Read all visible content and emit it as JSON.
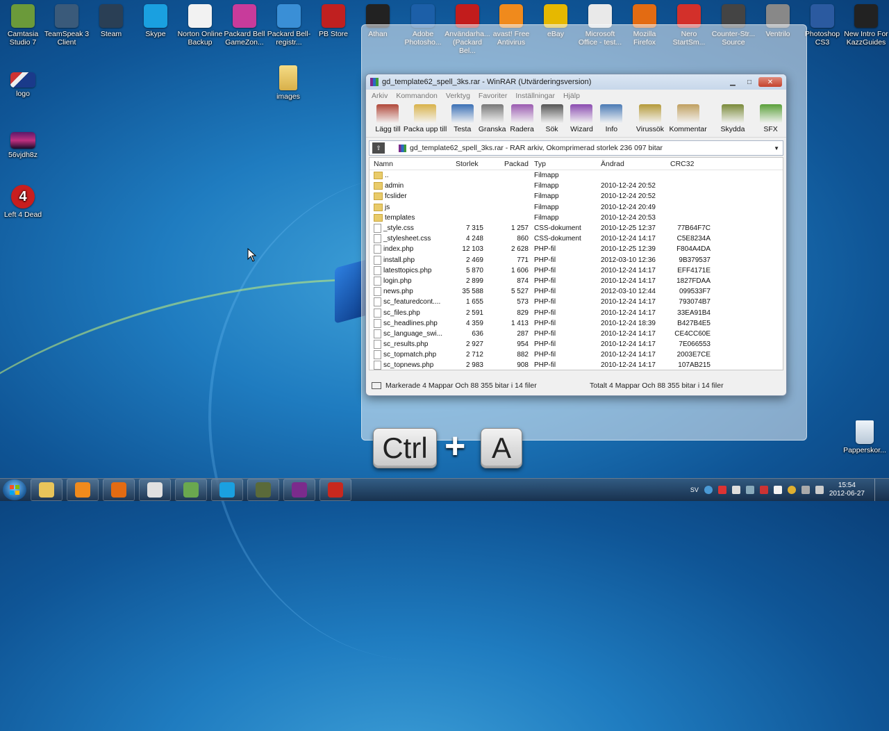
{
  "desktop": {
    "icons_top": [
      {
        "label": "Camtasia Studio 7",
        "icon": "camtasia-icon",
        "color": "#6b9a3a"
      },
      {
        "label": "TeamSpeak 3 Client",
        "icon": "teamspeak-icon",
        "color": "#3a5a7a"
      },
      {
        "label": "Steam",
        "icon": "steam-icon",
        "color": "#2a3f55"
      },
      {
        "label": "Skype",
        "icon": "skype-icon",
        "color": "#1aa0e0"
      },
      {
        "label": "Norton Online Backup",
        "icon": "norton-icon",
        "color": "#f2f2f2"
      },
      {
        "label": "Packard Bell GameZon...",
        "icon": "gamezone-icon",
        "color": "#c83b9b"
      },
      {
        "label": "Packard Bell-registr...",
        "icon": "packardbell-icon",
        "color": "#3a8fd6"
      },
      {
        "label": "PB Store",
        "icon": "pbstore-icon",
        "color": "#c02020"
      },
      {
        "label": "Athan",
        "icon": "athan-icon",
        "color": "#222222"
      },
      {
        "label": "Adobe Photosho...",
        "icon": "photoshop-elements-icon",
        "color": "#1c5fa8"
      },
      {
        "label": "Användarha... (Packard Bel...",
        "icon": "help-icon",
        "color": "#c21c1c"
      },
      {
        "label": "avast! Free Antivirus",
        "icon": "avast-icon",
        "color": "#f08a1c"
      },
      {
        "label": "eBay",
        "icon": "ebay-icon",
        "color": "#e6b800"
      },
      {
        "label": "Microsoft Office - test...",
        "icon": "office-icon",
        "color": "#e9e9e9"
      },
      {
        "label": "Mozilla Firefox",
        "icon": "firefox-icon",
        "color": "#e36b12"
      },
      {
        "label": "Nero StartSm...",
        "icon": "nero-icon",
        "color": "#d3302a"
      },
      {
        "label": "Counter-Str... Source",
        "icon": "counterstrike-icon",
        "color": "#444444"
      },
      {
        "label": "Ventrilo",
        "icon": "ventrilo-icon",
        "color": "#888888"
      },
      {
        "label": "Photoshop CS3",
        "icon": "photoshop-icon",
        "color": "#2b5aa0"
      },
      {
        "label": "New Intro For KazzGuides",
        "icon": "kazzguides-icon",
        "color": "#222222"
      }
    ],
    "icons_left": [
      {
        "label": "logo",
        "icon": "logo-image-icon"
      },
      {
        "label": "56vjdh8z",
        "icon": "image-file-icon"
      },
      {
        "label": "Left 4 Dead",
        "icon": "left4dead-icon"
      }
    ],
    "folder_label": "images",
    "recycle_label": "Papperskor..."
  },
  "winrar": {
    "title": "gd_template62_spell_3ks.rar - WinRAR (Utvärderingsversion)",
    "menu": [
      "Arkiv",
      "Kommandon",
      "Verktyg",
      "Favoriter",
      "Inställningar",
      "Hjälp"
    ],
    "toolbar": [
      {
        "label": "Lägg till",
        "icon": "add-archive-icon",
        "color": "#b0483a"
      },
      {
        "label": "Packa upp till",
        "icon": "extract-folder-icon",
        "color": "#d8b24a"
      },
      {
        "label": "Testa",
        "icon": "test-icon",
        "color": "#3a6fb5"
      },
      {
        "label": "Granska",
        "icon": "view-glasses-icon",
        "color": "#777777"
      },
      {
        "label": "Radera",
        "icon": "delete-icon",
        "color": "#9a5ab0"
      },
      {
        "label": "Sök",
        "icon": "find-binoculars-icon",
        "color": "#555555"
      },
      {
        "label": "Wizard",
        "icon": "wizard-icon",
        "color": "#8a4bb0"
      },
      {
        "label": "Info",
        "icon": "info-icon",
        "color": "#4a7ab5"
      },
      {
        "label": "Virussök",
        "icon": "virus-scan-icon",
        "color": "#b59a3a"
      },
      {
        "label": "Kommentar",
        "icon": "comment-icon",
        "color": "#c0a060"
      },
      {
        "label": "Skydda",
        "icon": "protect-shield-icon",
        "color": "#7a8a3a"
      },
      {
        "label": "SFX",
        "icon": "sfx-icon",
        "color": "#5aa03a"
      }
    ],
    "address": "gd_template62_spell_3ks.rar - RAR arkiv, Okomprimerad storlek 236 097 bitar",
    "columns": {
      "name": "Namn",
      "size": "Storlek",
      "packed": "Packad",
      "type": "Typ",
      "modified": "Ändrad",
      "crc": "CRC32"
    },
    "rows": [
      {
        "name": "..",
        "size": "",
        "packed": "",
        "type": "Filmapp",
        "modified": "",
        "crc": "",
        "kind": "folder"
      },
      {
        "name": "admin",
        "size": "",
        "packed": "",
        "type": "Filmapp",
        "modified": "2010-12-24 20:52",
        "crc": "",
        "kind": "folder"
      },
      {
        "name": "fcslider",
        "size": "",
        "packed": "",
        "type": "Filmapp",
        "modified": "2010-12-24 20:52",
        "crc": "",
        "kind": "folder"
      },
      {
        "name": "js",
        "size": "",
        "packed": "",
        "type": "Filmapp",
        "modified": "2010-12-24 20:49",
        "crc": "",
        "kind": "folder"
      },
      {
        "name": "templates",
        "size": "",
        "packed": "",
        "type": "Filmapp",
        "modified": "2010-12-24 20:53",
        "crc": "",
        "kind": "folder"
      },
      {
        "name": "_style.css",
        "size": "7 315",
        "packed": "1 257",
        "type": "CSS-dokument",
        "modified": "2010-12-25 12:37",
        "crc": "77B64F7C",
        "kind": "file"
      },
      {
        "name": "_stylesheet.css",
        "size": "4 248",
        "packed": "860",
        "type": "CSS-dokument",
        "modified": "2010-12-24 14:17",
        "crc": "C5E8234A",
        "kind": "file"
      },
      {
        "name": "index.php",
        "size": "12 103",
        "packed": "2 628",
        "type": "PHP-fil",
        "modified": "2010-12-25 12:39",
        "crc": "F804A4DA",
        "kind": "file"
      },
      {
        "name": "install.php",
        "size": "2 469",
        "packed": "771",
        "type": "PHP-fil",
        "modified": "2012-03-10 12:36",
        "crc": "9B379537",
        "kind": "file"
      },
      {
        "name": "latesttopics.php",
        "size": "5 870",
        "packed": "1 606",
        "type": "PHP-fil",
        "modified": "2010-12-24 14:17",
        "crc": "EFF4171E",
        "kind": "file"
      },
      {
        "name": "login.php",
        "size": "2 899",
        "packed": "874",
        "type": "PHP-fil",
        "modified": "2010-12-24 14:17",
        "crc": "1827FDAA",
        "kind": "file"
      },
      {
        "name": "news.php",
        "size": "35 588",
        "packed": "5 527",
        "type": "PHP-fil",
        "modified": "2012-03-10 12:44",
        "crc": "099533F7",
        "kind": "file"
      },
      {
        "name": "sc_featuredcont....",
        "size": "1 655",
        "packed": "573",
        "type": "PHP-fil",
        "modified": "2010-12-24 14:17",
        "crc": "793074B7",
        "kind": "file"
      },
      {
        "name": "sc_files.php",
        "size": "2 591",
        "packed": "829",
        "type": "PHP-fil",
        "modified": "2010-12-24 14:17",
        "crc": "33EA91B4",
        "kind": "file"
      },
      {
        "name": "sc_headlines.php",
        "size": "4 359",
        "packed": "1 413",
        "type": "PHP-fil",
        "modified": "2010-12-24 18:39",
        "crc": "B427B4E5",
        "kind": "file"
      },
      {
        "name": "sc_language_swi...",
        "size": "636",
        "packed": "287",
        "type": "PHP-fil",
        "modified": "2010-12-24 14:17",
        "crc": "CE4CC60E",
        "kind": "file"
      },
      {
        "name": "sc_results.php",
        "size": "2 927",
        "packed": "954",
        "type": "PHP-fil",
        "modified": "2010-12-24 14:17",
        "crc": "7E066553",
        "kind": "file"
      },
      {
        "name": "sc_topmatch.php",
        "size": "2 712",
        "packed": "882",
        "type": "PHP-fil",
        "modified": "2010-12-24 14:17",
        "crc": "2003E7CE",
        "kind": "file"
      },
      {
        "name": "sc_topnews.php",
        "size": "2 983",
        "packed": "908",
        "type": "PHP-fil",
        "modified": "2010-12-24 14:17",
        "crc": "107AB215",
        "kind": "file"
      }
    ],
    "status_left": "Markerade 4 Mappar Och 88 355 bitar i 14 filer",
    "status_right": "Totalt 4 Mappar Och 88 355 bitar i 14 filer"
  },
  "overlay": {
    "key1": "Ctrl",
    "plus": "+",
    "key2": "A"
  },
  "taskbar": {
    "apps": [
      {
        "icon": "explorer-icon",
        "color": "#e8c45a"
      },
      {
        "icon": "media-player-icon",
        "color": "#f08a1c"
      },
      {
        "icon": "firefox-icon",
        "color": "#e36b12"
      },
      {
        "icon": "notepad-icon",
        "color": "#e0e0e0"
      },
      {
        "icon": "network-icon",
        "color": "#6aa84f"
      },
      {
        "icon": "skype-icon",
        "color": "#1aa0e0"
      },
      {
        "icon": "teamspeak-icon",
        "color": "#5a6a3a"
      },
      {
        "icon": "winrar-icon",
        "color": "#7b2b8c"
      },
      {
        "icon": "filezilla-icon",
        "color": "#c8281e"
      }
    ],
    "lang": "SV",
    "time": "15:54",
    "date": "2012-06-27"
  }
}
